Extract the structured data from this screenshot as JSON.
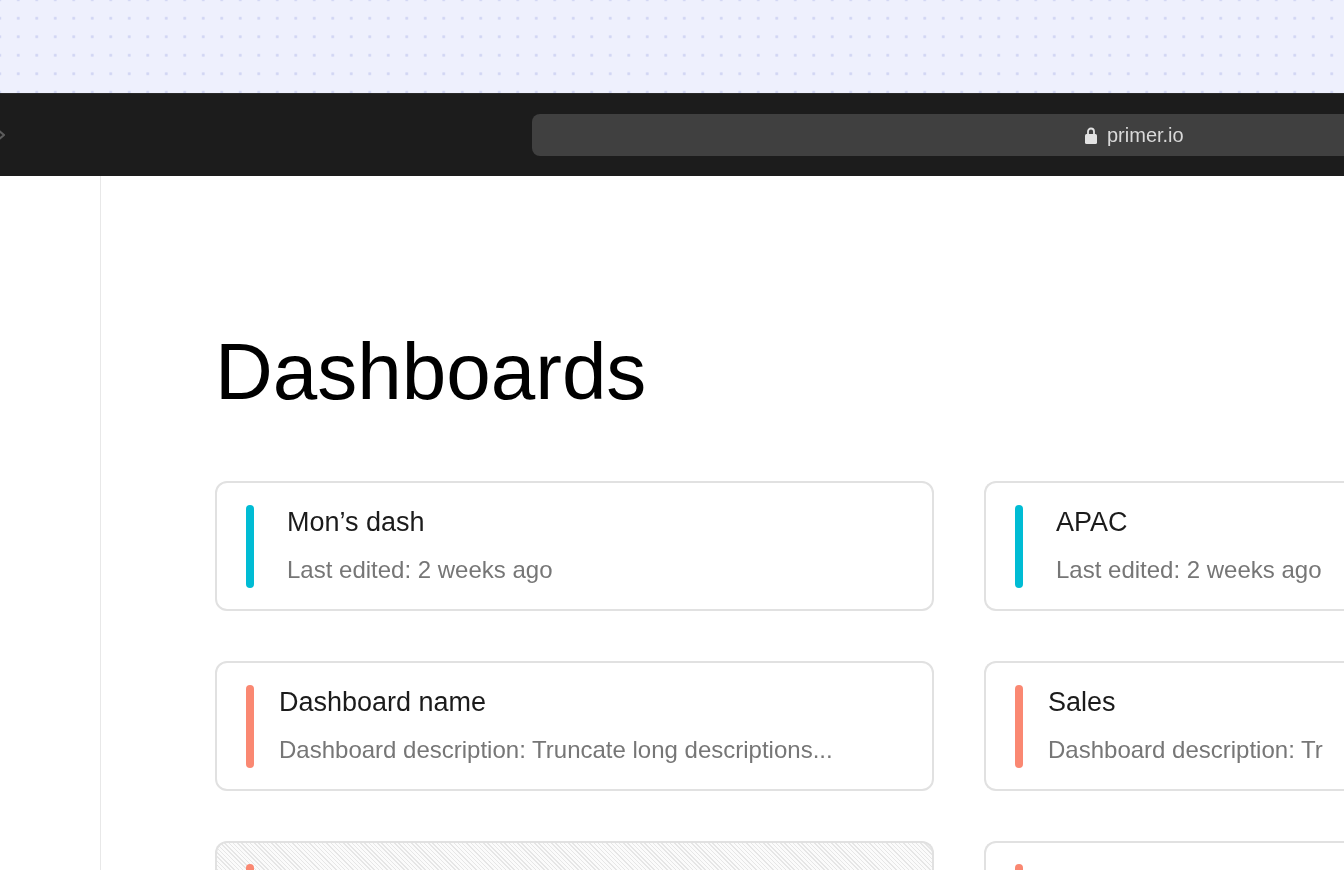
{
  "browser": {
    "url": "primer.io",
    "secure": true
  },
  "page": {
    "title": "Dashboards"
  },
  "cards": [
    {
      "title": "Mon’s dash",
      "last_edited": "Last edited: 2 weeks ago",
      "color": "#00bcd4",
      "hovered": false
    },
    {
      "title": "APAC",
      "last_edited": "Last edited: 2 weeks ago",
      "color": "#00bcd4",
      "hovered": false
    },
    {
      "title": "Dashboard name",
      "description": "Dashboard description: Truncate long descriptions...",
      "color": "#fa8872",
      "hovered": false
    },
    {
      "title": "Sales",
      "description": "Dashboard description: Tr",
      "color": "#fa8872",
      "hovered": false
    },
    {
      "color": "#fa8872",
      "hovered": true
    },
    {
      "color": "#fa8872",
      "hovered": false
    }
  ]
}
